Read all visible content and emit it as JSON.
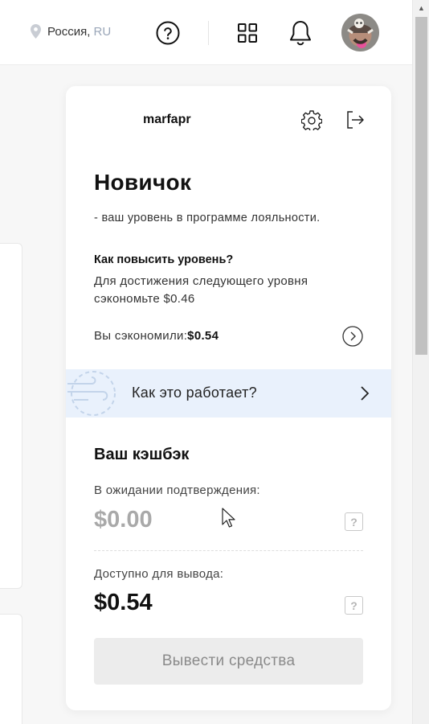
{
  "header": {
    "location_country": "Россия,",
    "location_code": "RU",
    "help_icon": "question-circle-icon",
    "apps_icon": "grid-icon",
    "notifications_icon": "bell-icon"
  },
  "profile": {
    "username": "marfapr",
    "settings_icon": "gear-icon",
    "logout_icon": "logout-icon"
  },
  "loyalty": {
    "level_title": "Новичок",
    "level_desc": "- ваш уровень в программе лояльности.",
    "how_up_title": "Как повысить уровень?",
    "how_up_text": "Для достижения следующего уровня сэкономьте $0.46",
    "saved_label": "Вы сэкономили:",
    "saved_value": "$0.54"
  },
  "how_it_works": {
    "label": "Как это работает?"
  },
  "cashback": {
    "title": "Ваш кэшбэк",
    "pending_label": "В ожидании подтверждения:",
    "pending_value": "$0.00",
    "available_label": "Доступно для вывода:",
    "available_value": "$0.54",
    "help_glyph": "?",
    "withdraw_button": "Вывести средства"
  },
  "colors": {
    "banner_bg": "#e9f1fc",
    "pending_value": "#a9a9a9",
    "button_bg": "#ececec"
  }
}
